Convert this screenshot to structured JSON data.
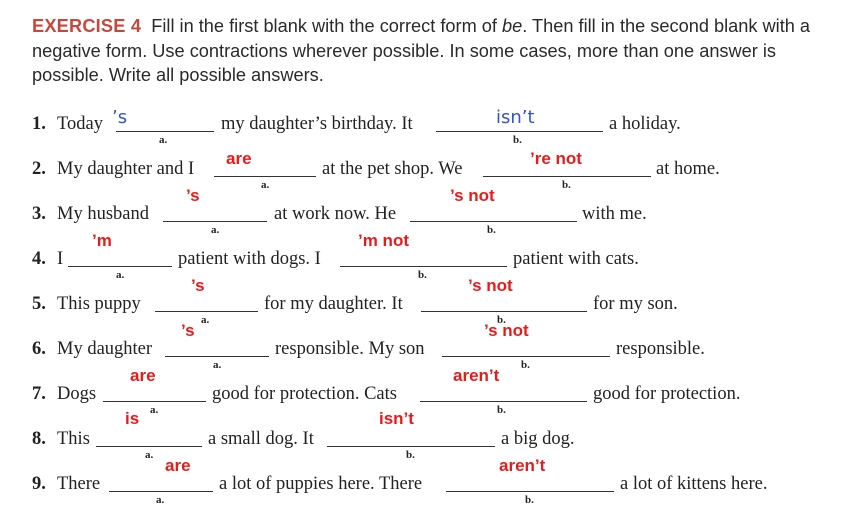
{
  "header": {
    "label": "EXERCISE 4",
    "text_before_be": "Fill in the first blank with the correct form of ",
    "be": "be",
    "text_after_be": ". Then fill in the second blank with a negative form. Use contractions wherever possible. In some cases, more than one answer is possible. Write all possible answers."
  },
  "items": [
    {
      "num": "1.",
      "t1": "Today",
      "t2": "my daughter’s birthday. It",
      "t3": "a holiday.",
      "ansA": "’s",
      "ansB": "isn’t",
      "subA": "a.",
      "subB": "b."
    },
    {
      "num": "2.",
      "t1": "My daughter and I",
      "t2": "at the pet shop. We",
      "t3": "at home.",
      "ansA": "are",
      "ansB": "’re not",
      "subA": "a.",
      "subB": "b."
    },
    {
      "num": "3.",
      "t1": "My husband",
      "t2": "at work now. He",
      "t3": "with me.",
      "ansA": "’s",
      "ansB": "’s not",
      "subA": "a.",
      "subB": "b."
    },
    {
      "num": "4.",
      "t1": "I",
      "t2": "patient with dogs. I",
      "t3": "patient with cats.",
      "ansA": "’m",
      "ansB": "’m not",
      "subA": "a.",
      "subB": "b."
    },
    {
      "num": "5.",
      "t1": "This puppy",
      "t2": "for my daughter. It",
      "t3": "for my son.",
      "ansA": "’s",
      "ansB": "’s not",
      "subA": "a.",
      "subB": "b."
    },
    {
      "num": "6.",
      "t1": "My daughter",
      "t2": "responsible. My son",
      "t3": "responsible.",
      "ansA": "’s",
      "ansB": "’s not",
      "subA": "a.",
      "subB": "b."
    },
    {
      "num": "7.",
      "t1": "Dogs",
      "t2": "good for protection. Cats",
      "t3": "good for protection.",
      "ansA": "are",
      "ansB": "aren’t",
      "subA": "a.",
      "subB": "b."
    },
    {
      "num": "8.",
      "t1": "This",
      "t2": "a small dog. It",
      "t3": "a big dog.",
      "ansA": "is",
      "ansB": "isn’t",
      "subA": "a.",
      "subB": "b."
    },
    {
      "num": "9.",
      "t1": "There",
      "t2": "a lot of puppies here. There",
      "t3": "a lot of kittens here.",
      "ansA": "are",
      "ansB": "aren’t",
      "subA": "a.",
      "subB": "b."
    }
  ],
  "colors": {
    "label": "#c8473a",
    "answer": "#e81b1b",
    "handwriting": "#3554c7"
  }
}
